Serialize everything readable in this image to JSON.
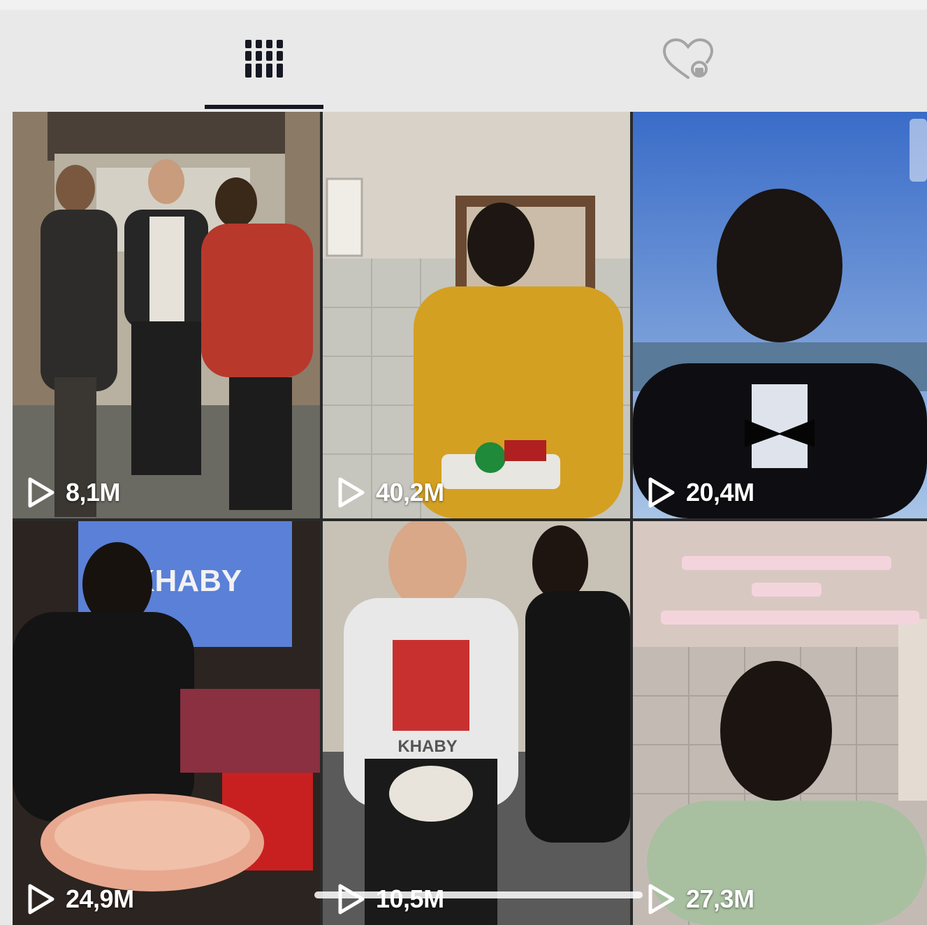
{
  "tabs": [
    {
      "id": "videos",
      "icon": "grid-icon",
      "active": true
    },
    {
      "id": "liked",
      "icon": "heart-lock-icon",
      "active": false
    }
  ],
  "videos": [
    {
      "views": "8,1M",
      "scene": "group-three-men-hallway"
    },
    {
      "views": "40,2M",
      "scene": "man-yellow-shirt-kitchen"
    },
    {
      "views": "20,4M",
      "scene": "man-tuxedo-beach"
    },
    {
      "views": "24,9M",
      "scene": "man-with-khaby-sign"
    },
    {
      "views": "10,5M",
      "scene": "two-men-kitchen"
    },
    {
      "views": "27,3M",
      "scene": "man-green-hoodie"
    }
  ],
  "thumbnail_overlay_text": {
    "sign": "KHABY",
    "shirt": "KHABY"
  },
  "colors": {
    "tab_active": "#161823",
    "tab_inactive": "#a4a4a4",
    "background": "#e9e9e9",
    "view_text": "#ffffff"
  }
}
